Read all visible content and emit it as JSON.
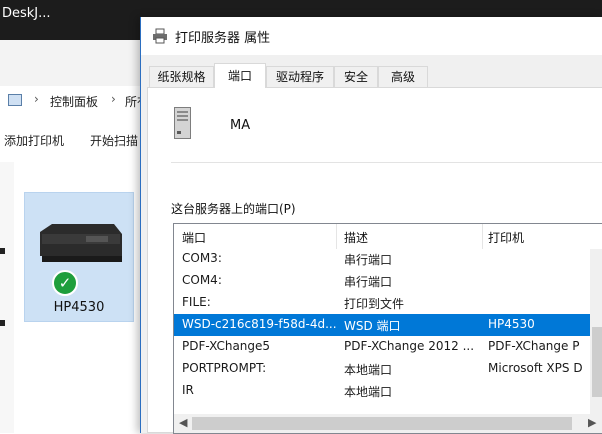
{
  "background_window": {
    "title_fragment": "DeskJ...",
    "breadcrumb": [
      "控制面板",
      "所有"
    ],
    "toolbar": {
      "add_printer": "添加打印机",
      "start_scan": "开始扫描"
    },
    "device": {
      "name": "HP4530",
      "status": "default-printer-check"
    }
  },
  "dialog": {
    "title": "打印服务器 属性",
    "tabs": [
      "纸张规格",
      "端口",
      "驱动程序",
      "安全",
      "高级"
    ],
    "active_tab": "端口",
    "server_name": "MA",
    "ports_label": "这台服务器上的端口(P)",
    "columns": [
      "端口",
      "描述",
      "打印机"
    ],
    "rows": [
      {
        "port": "COM3:",
        "desc": "串行端口",
        "printer": ""
      },
      {
        "port": "COM4:",
        "desc": "串行端口",
        "printer": ""
      },
      {
        "port": "FILE:",
        "desc": "打印到文件",
        "printer": ""
      },
      {
        "port": "WSD-c216c819-f58d-4d...",
        "desc": "WSD 端口",
        "printer": "HP4530"
      },
      {
        "port": "PDF-XChange5",
        "desc": "PDF-XChange 2012 ...",
        "printer": "PDF-XChange P"
      },
      {
        "port": "PORTPROMPT:",
        "desc": "本地端口",
        "printer": "Microsoft XPS D"
      },
      {
        "port": "IR",
        "desc": "本地端口",
        "printer": ""
      }
    ],
    "selected_row": 3,
    "colors": {
      "selection": "#0078d7",
      "accent_border": "#2b6ec0"
    }
  }
}
